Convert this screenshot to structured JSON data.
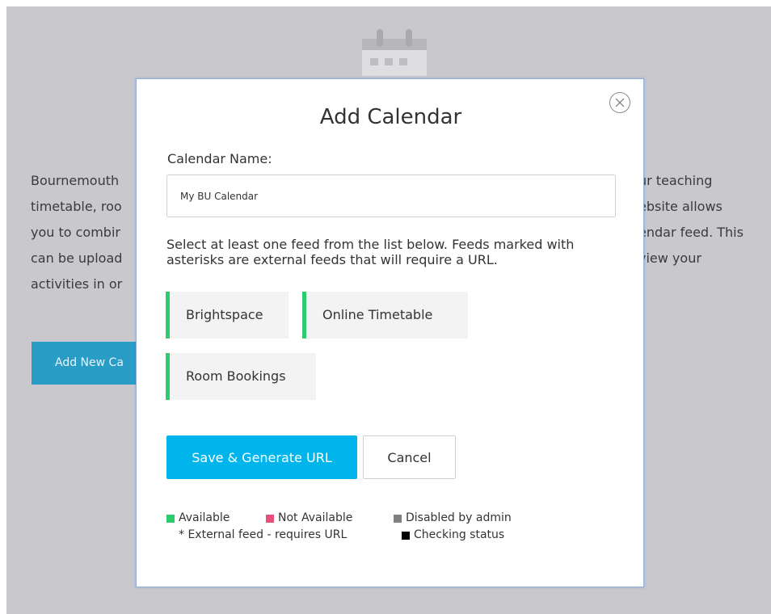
{
  "background": {
    "lines": [
      {
        "left": "Bournemouth",
        "right": "ur teaching"
      },
      {
        "left": "timetable, roo",
        "right": "ebsite allows"
      },
      {
        "left": "you to combir",
        "right": "endar feed. This"
      },
      {
        "left": "can be upload",
        "right": "view your"
      },
      {
        "left": "activities in or",
        "right": ""
      }
    ],
    "button_label": "Add New Ca"
  },
  "modal": {
    "title": "Add Calendar",
    "name_label": "Calendar Name:",
    "name_value": "My BU Calendar",
    "instructions": "Select at least one feed from the list below. Feeds marked with asterisks are external feeds that will require a URL.",
    "feeds": [
      {
        "label": "Brightspace",
        "status": "available"
      },
      {
        "label": "Online Timetable",
        "status": "available"
      },
      {
        "label": "Room Bookings",
        "status": "available"
      }
    ],
    "save_label": "Save & Generate URL",
    "cancel_label": "Cancel",
    "legend": {
      "available": "Available",
      "not_available": "Not Available",
      "disabled": "Disabled by admin",
      "external": "* External feed - requires URL",
      "checking": "Checking status"
    }
  },
  "colors": {
    "available": "#2ecc71",
    "not_available": "#e8507a",
    "disabled": "#808080",
    "checking": "#000000",
    "primary": "#00b4ec"
  }
}
